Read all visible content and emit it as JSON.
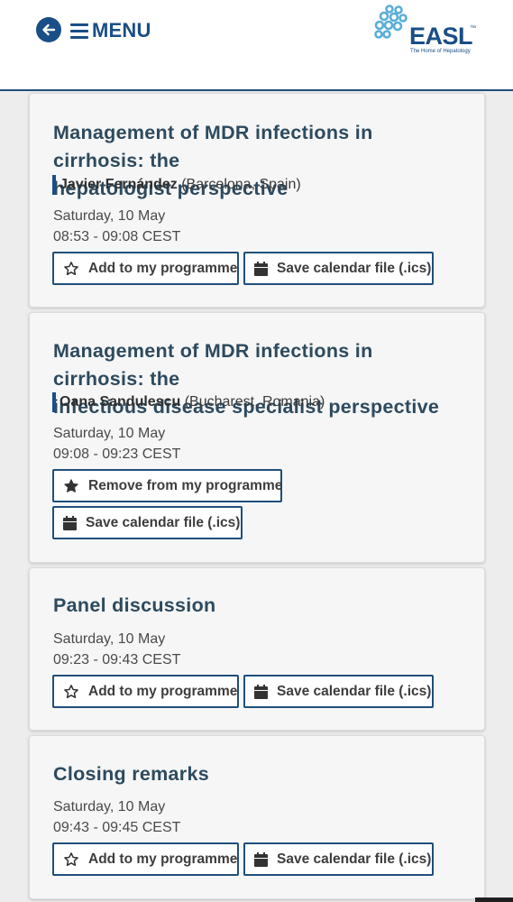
{
  "header": {
    "menu_label": "MENU",
    "logo_text": "EASL",
    "logo_tm": "™",
    "logo_tagline": "The Home of Hepatology",
    "brand_color": "#1a4e86"
  },
  "sessions": [
    {
      "title_line1": "Management of MDR infections in cirrhosis: the",
      "title_line2": "hepatologist perspective",
      "speaker_name": "Javier Fernández",
      "speaker_location": "(Barcelona, Spain)",
      "date": "Saturday, 10 May",
      "time": "08:53 - 09:08 CEST",
      "programme_button": "Add to my programme",
      "programme_icon": "star-outline-icon",
      "calendar_button": "Save calendar file (.ics)"
    },
    {
      "title_line1": "Management of MDR infections in cirrhosis: the",
      "title_line2": "infectious disease specialist perspective",
      "speaker_name": "Oana Sandulescu",
      "speaker_location": "(Bucharest, Romania)",
      "date": "Saturday, 10 May",
      "time": "09:08 - 09:23 CEST",
      "programme_button": "Remove from my programme",
      "programme_icon": "star-filled-icon",
      "calendar_button": "Save calendar file (.ics)"
    },
    {
      "title_line1": "Panel discussion",
      "date": "Saturday, 10 May",
      "time": "09:23 - 09:43 CEST",
      "programme_button": "Add to my programme",
      "programme_icon": "star-outline-icon",
      "calendar_button": "Save calendar file (.ics)"
    },
    {
      "title_line1": "Closing remarks",
      "date": "Saturday, 10 May",
      "time": "09:43 - 09:45 CEST",
      "programme_button": "Add to my programme",
      "programme_icon": "star-outline-icon",
      "calendar_button": "Save calendar file (.ics)"
    }
  ]
}
